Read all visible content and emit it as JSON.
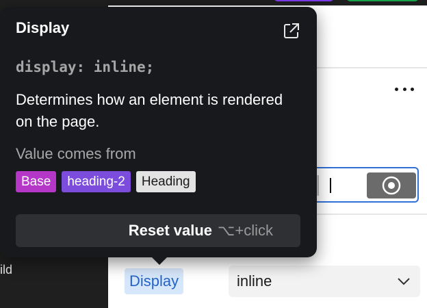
{
  "tooltip": {
    "title": "Display",
    "code": "display: inline;",
    "description": "Determines how an element is rendered on the page.",
    "source_label": "Value comes from",
    "tags": [
      {
        "label": "Base",
        "color": "#b437c8"
      },
      {
        "label": "heading-2",
        "color": "#7c4ddc"
      },
      {
        "label": "Heading",
        "color": "#e3e3e3"
      }
    ],
    "reset_label": "Reset value",
    "reset_hint": "⌥+click",
    "external_icon": "external-link-icon"
  },
  "sidebar": {
    "partial_label": "ild"
  },
  "property": {
    "label": "Display",
    "value": "inline",
    "label_color": "#2464c8"
  },
  "colors": {
    "tooltip_bg": "#17191c",
    "accent_blue": "#2f6fd6"
  }
}
